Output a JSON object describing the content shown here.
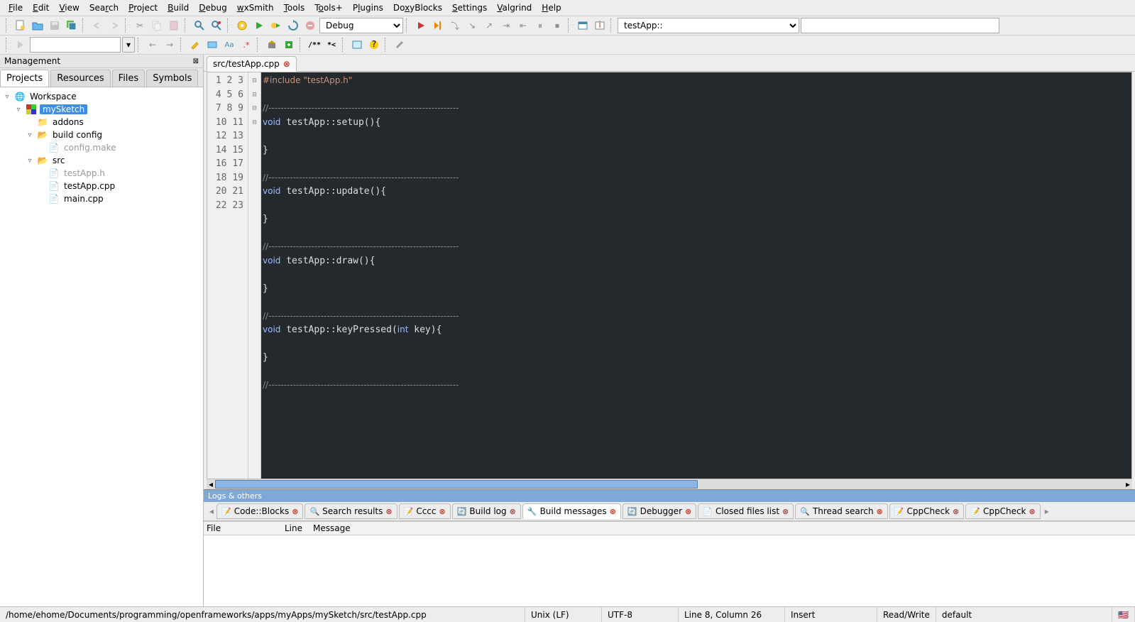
{
  "menu": [
    "File",
    "Edit",
    "View",
    "Search",
    "Project",
    "Build",
    "Debug",
    "wxSmith",
    "Tools",
    "Tools+",
    "Plugins",
    "DoxyBlocks",
    "Settings",
    "Valgrind",
    "Help"
  ],
  "toolbar": {
    "build_target": "Debug",
    "symbol_scope": "testApp::",
    "symbol_filter": ""
  },
  "management": {
    "title": "Management",
    "tabs": [
      "Projects",
      "Resources",
      "Files",
      "Symbols"
    ],
    "active_tab": 0,
    "tree": {
      "workspace": "Workspace",
      "project": "mySketch",
      "folders": {
        "addons": "addons",
        "build_config": "build config",
        "config_make": "config.make",
        "src": "src"
      },
      "files": [
        "testApp.h",
        "testApp.cpp",
        "main.cpp"
      ]
    }
  },
  "editor": {
    "tab": "src/testApp.cpp",
    "lines": [
      {
        "n": 1,
        "t": "#include \"testApp.h\"",
        "cls": "c-pre"
      },
      {
        "n": 2,
        "t": "",
        "cls": ""
      },
      {
        "n": 3,
        "t": "//--------------------------------------------------------------",
        "cls": "c-com"
      },
      {
        "n": 4,
        "t": "void testApp::setup(){",
        "cls": "c-kw",
        "fold": "-"
      },
      {
        "n": 5,
        "t": "",
        "cls": ""
      },
      {
        "n": 6,
        "t": "}",
        "cls": ""
      },
      {
        "n": 7,
        "t": "",
        "cls": ""
      },
      {
        "n": 8,
        "t": "//--------------------------------------------------------------",
        "cls": "c-com"
      },
      {
        "n": 9,
        "t": "void testApp::update(){",
        "cls": "c-kw",
        "fold": "-"
      },
      {
        "n": 10,
        "t": "",
        "cls": ""
      },
      {
        "n": 11,
        "t": "}",
        "cls": ""
      },
      {
        "n": 12,
        "t": "",
        "cls": ""
      },
      {
        "n": 13,
        "t": "//--------------------------------------------------------------",
        "cls": "c-com"
      },
      {
        "n": 14,
        "t": "void testApp::draw(){",
        "cls": "c-kw",
        "fold": "-"
      },
      {
        "n": 15,
        "t": "",
        "cls": ""
      },
      {
        "n": 16,
        "t": "}",
        "cls": ""
      },
      {
        "n": 17,
        "t": "",
        "cls": ""
      },
      {
        "n": 18,
        "t": "//--------------------------------------------------------------",
        "cls": "c-com"
      },
      {
        "n": 19,
        "t": "void testApp::keyPressed(int key){",
        "cls": "c-kw",
        "fold": "-"
      },
      {
        "n": 20,
        "t": "",
        "cls": ""
      },
      {
        "n": 21,
        "t": "}",
        "cls": ""
      },
      {
        "n": 22,
        "t": "",
        "cls": ""
      },
      {
        "n": 23,
        "t": "//--------------------------------------------------------------",
        "cls": "c-com"
      }
    ]
  },
  "logs": {
    "header": "Logs & others",
    "tabs": [
      "Code::Blocks",
      "Search results",
      "Cccc",
      "Build log",
      "Build messages",
      "Debugger",
      "Closed files list",
      "Thread search",
      "CppCheck",
      "CppCheck"
    ],
    "active": 4,
    "columns": [
      "File",
      "Line",
      "Message"
    ]
  },
  "status": {
    "path": "/home/ehome/Documents/programming/openframeworks/apps/myApps/mySketch/src/testApp.cpp",
    "eol": "Unix (LF)",
    "enc": "UTF-8",
    "pos": "Line 8, Column 26",
    "ins": "Insert",
    "rw": "Read/Write",
    "profile": "default"
  }
}
